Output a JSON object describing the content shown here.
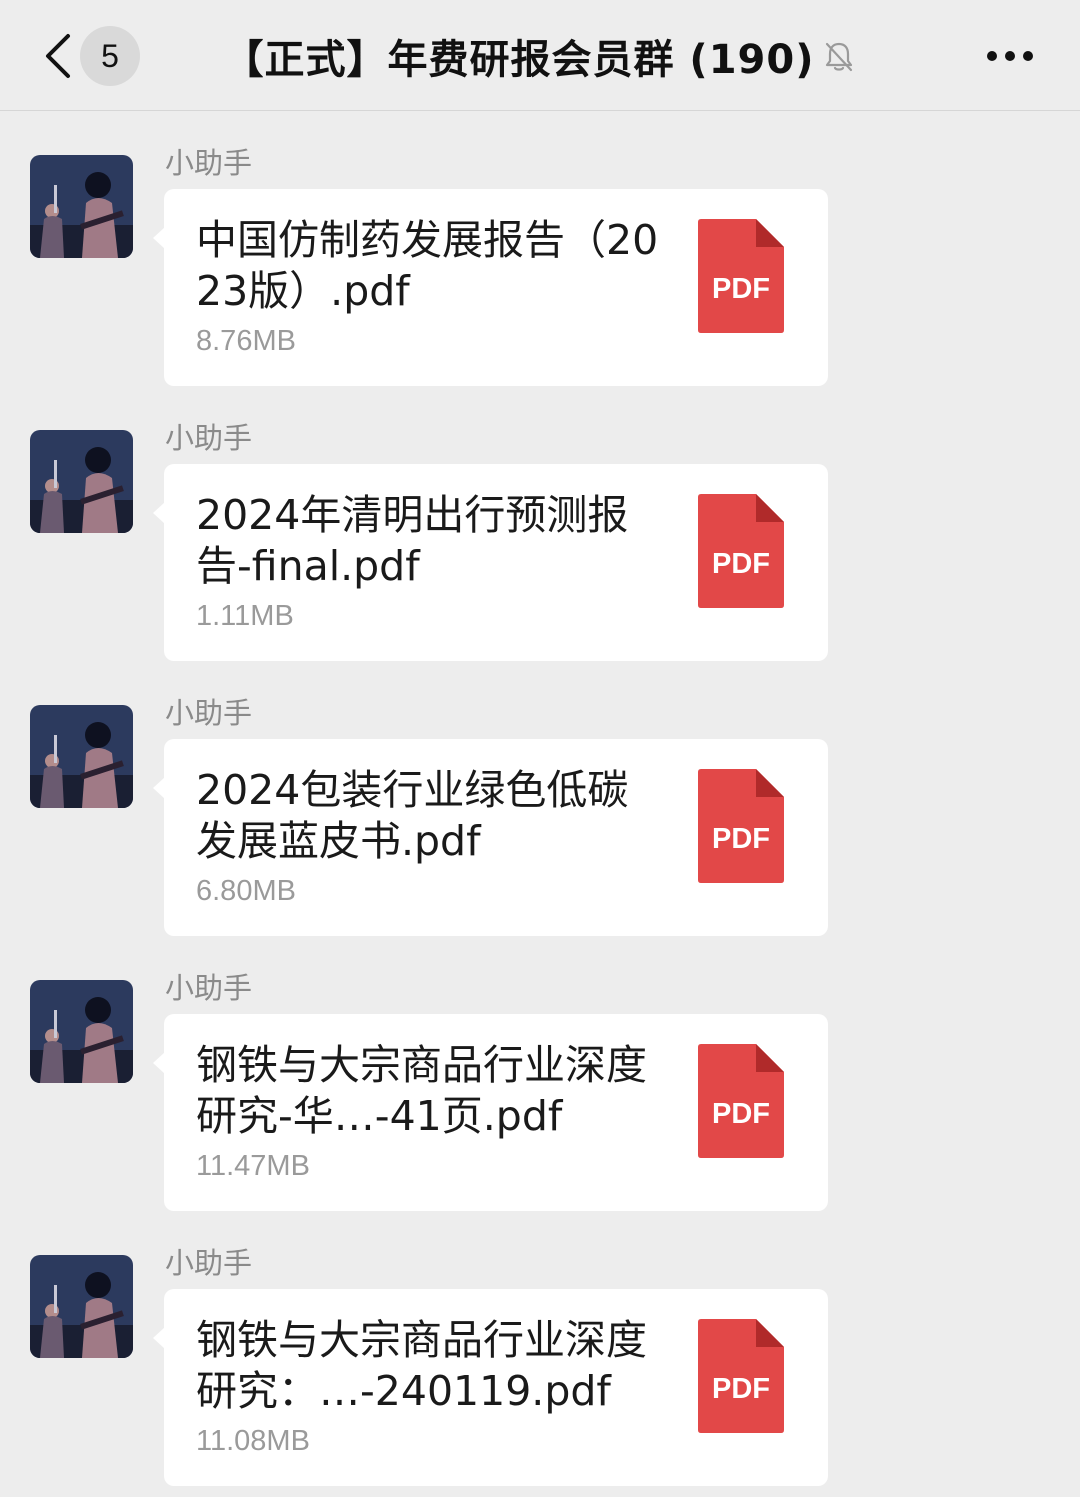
{
  "header": {
    "back_label": "",
    "unread_count": "5",
    "title": "【正式】年费研报会员群 (190)",
    "muted": true
  },
  "colors": {
    "background": "#ededed",
    "bubble": "#ffffff",
    "pdf_red": "#e24848",
    "pdf_fold": "#b02a2a",
    "sender_gray": "#8a8a8a",
    "size_gray": "#9a9a9a"
  },
  "messages": [
    {
      "sender": "小助手",
      "file_name": "中国仿制药发展报告（2023版）.pdf",
      "file_size": "8.76MB",
      "file_type": "PDF"
    },
    {
      "sender": "小助手",
      "file_name": "2024年清明出行预测报告-final.pdf",
      "file_size": "1.11MB",
      "file_type": "PDF"
    },
    {
      "sender": "小助手",
      "file_name": "2024包装行业绿色低碳发展蓝皮书.pdf",
      "file_size": "6.80MB",
      "file_type": "PDF"
    },
    {
      "sender": "小助手",
      "file_name": "钢铁与大宗商品行业深度研究-华…-41页.pdf",
      "file_size": "11.47MB",
      "file_type": "PDF"
    },
    {
      "sender": "小助手",
      "file_name": "钢铁与大宗商品行业深度研究：…-240119.pdf",
      "file_size": "11.08MB",
      "file_type": "PDF"
    }
  ]
}
